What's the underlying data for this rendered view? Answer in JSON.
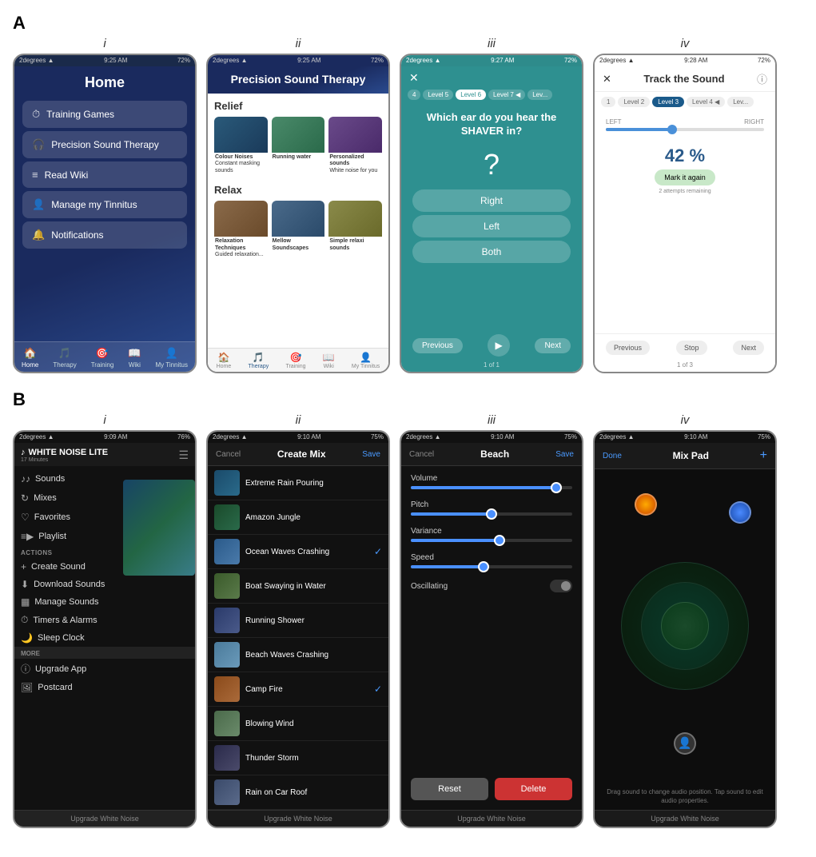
{
  "sectionA": {
    "label": "A",
    "columns": [
      "i",
      "ii",
      "iii",
      "iv"
    ],
    "screen_ai": {
      "title": "Home",
      "menu": [
        {
          "icon": "⏱",
          "label": "Training Games"
        },
        {
          "icon": "🎧",
          "label": "Precision Sound Therapy"
        },
        {
          "icon": "≡",
          "label": "Read Wiki"
        },
        {
          "icon": "👤",
          "label": "Manage my Tinnitus"
        },
        {
          "icon": "🔔",
          "label": "Notifications"
        }
      ],
      "nav": [
        {
          "icon": "🏠",
          "label": "Home",
          "active": true
        },
        {
          "icon": "🎵",
          "label": "Therapy"
        },
        {
          "icon": "🎯",
          "label": "Training"
        },
        {
          "icon": "📖",
          "label": "Wiki"
        },
        {
          "icon": "👤",
          "label": "My Tinnitus"
        }
      ],
      "status": {
        "left": "2degrees ▲",
        "center": "9:25 AM",
        "right": "72%"
      }
    },
    "screen_aii": {
      "title": "Precision Sound Therapy",
      "sections": [
        {
          "label": "Relief",
          "cards": [
            {
              "label": "Colour Noises",
              "sub": "Constant masking sounds"
            },
            {
              "label": "Running water",
              "sub": ""
            },
            {
              "label": "Personalized sounds",
              "sub": "White noise for you"
            }
          ]
        },
        {
          "label": "Relax",
          "cards": [
            {
              "label": "Relaxation Techniques",
              "sub": "Guided relaxation..."
            },
            {
              "label": "Mellow Soundscapes",
              "sub": ""
            },
            {
              "label": "Simple relaxi sounds",
              "sub": ""
            }
          ]
        }
      ],
      "nav": [
        {
          "icon": "🏠",
          "label": "Home"
        },
        {
          "icon": "🎵",
          "label": "Therapy",
          "active": true
        },
        {
          "icon": "🎯",
          "label": "Training"
        },
        {
          "icon": "📖",
          "label": "Wiki"
        },
        {
          "icon": "👤",
          "label": "My Tinnitus"
        }
      ],
      "status": {
        "left": "2degrees ▲",
        "center": "9:25 AM",
        "right": "72%"
      }
    },
    "screen_aiii": {
      "close_icon": "✕",
      "levels": [
        "4",
        "Level 5",
        "Level 6",
        "Level 7 ◀",
        "Lev..."
      ],
      "active_level": "Level 6",
      "question": "Which ear do you hear the SHAVER in?",
      "question_mark": "?",
      "answers": [
        "Right",
        "Left",
        "Both"
      ],
      "prev_label": "Previous",
      "next_label": "Next",
      "page_count": "1 of 1",
      "status": {
        "left": "2degrees ▲",
        "center": "9:27 AM",
        "right": "72%"
      }
    },
    "screen_aiv": {
      "close_icon": "✕",
      "title": "Track the Sound",
      "info_icon": "ⓘ",
      "levels": [
        "1",
        "Level 2",
        "Level 3",
        "Level 4 ◀",
        "Lev..."
      ],
      "active_level": "Level 3",
      "lr_left": "LEFT",
      "lr_right": "RIGHT",
      "percent": "42 %",
      "mark_label": "Mark it again",
      "attempts": "2 attempts remaining",
      "prev_label": "Previous",
      "stop_label": "Stop",
      "next_label": "Next",
      "page_count": "1 of 3",
      "status": {
        "left": "2degrees ▲",
        "center": "9:28 AM",
        "right": "72%"
      }
    }
  },
  "sectionB": {
    "label": "B",
    "columns": [
      "i",
      "ii",
      "iii",
      "iv"
    ],
    "screen_bi": {
      "app_title": "WHITE NOISE LITE",
      "app_subtitle": "17 Minutes",
      "menu_icon": "☰",
      "sidebar_items": [
        {
          "icon": "♪♪",
          "label": "Sounds"
        },
        {
          "icon": "↻",
          "label": "Mixes"
        },
        {
          "icon": "♡",
          "label": "Favorites"
        },
        {
          "icon": "≡▶",
          "label": "Playlist"
        }
      ],
      "actions_label": "ACTIONS",
      "actions": [
        {
          "icon": "+",
          "label": "Create Sound"
        },
        {
          "icon": "⬇",
          "label": "Download Sounds"
        },
        {
          "icon": "▦",
          "label": "Manage Sounds"
        },
        {
          "icon": "⏱",
          "label": "Timers & Alarms"
        },
        {
          "icon": "🌙",
          "label": "Sleep Clock"
        }
      ],
      "more_label": "MORE",
      "more_items": [
        {
          "icon": "ⓘ",
          "label": "Upgrade App"
        },
        {
          "icon": "🖼",
          "label": "Postcard"
        }
      ],
      "upgrade_bar": "Upgrade White Noise",
      "status": {
        "left": "2degrees ▲",
        "center": "9:09 AM",
        "right": "76%"
      }
    },
    "screen_bii": {
      "cancel_label": "Cancel",
      "title": "Create Mix",
      "save_label": "Save",
      "sounds": [
        {
          "label": "Extreme Rain Pouring",
          "thumb_class": "thumb-extreme",
          "checked": false
        },
        {
          "label": "Amazon Jungle",
          "thumb_class": "thumb-jungle",
          "checked": false
        },
        {
          "label": "Ocean Waves Crashing",
          "thumb_class": "thumb-ocean",
          "checked": true
        },
        {
          "label": "Boat Swaying in Water",
          "thumb_class": "thumb-boat",
          "checked": false
        },
        {
          "label": "Running Shower",
          "thumb_class": "thumb-shower",
          "checked": false
        },
        {
          "label": "Beach Waves Crashing",
          "thumb_class": "thumb-beach",
          "checked": false
        },
        {
          "label": "Camp Fire",
          "thumb_class": "thumb-campfire",
          "checked": true
        },
        {
          "label": "Blowing Wind",
          "thumb_class": "thumb-wind",
          "checked": false
        },
        {
          "label": "Thunder Storm",
          "thumb_class": "thumb-thunder",
          "checked": false
        },
        {
          "label": "Rain on Car Roof",
          "thumb_class": "thumb-rain",
          "checked": false
        }
      ],
      "upgrade_bar": "Upgrade White Noise",
      "status": {
        "left": "2degrees ▲",
        "center": "9:10 AM",
        "right": "75%"
      }
    },
    "screen_biii": {
      "cancel_label": "Cancel",
      "title": "Beach",
      "save_label": "Save",
      "sliders": [
        {
          "label": "Volume",
          "fill_pct": 90
        },
        {
          "label": "Pitch",
          "fill_pct": 50
        },
        {
          "label": "Variance",
          "fill_pct": 55
        },
        {
          "label": "Speed",
          "fill_pct": 45
        }
      ],
      "toggle_label": "Oscillating",
      "reset_label": "Reset",
      "delete_label": "Delete",
      "upgrade_bar": "Upgrade White Noise",
      "status": {
        "left": "2degrees ▲",
        "center": "9:10 AM",
        "right": "75%"
      }
    },
    "screen_biv": {
      "done_label": "Done",
      "title": "Mix Pad",
      "add_icon": "+",
      "hint": "Drag sound to change audio position. Tap sound to edit audio properties.",
      "upgrade_bar": "Upgrade White Noise",
      "status": {
        "left": "2degrees ▲",
        "center": "9:10 AM",
        "right": "75%"
      }
    }
  }
}
